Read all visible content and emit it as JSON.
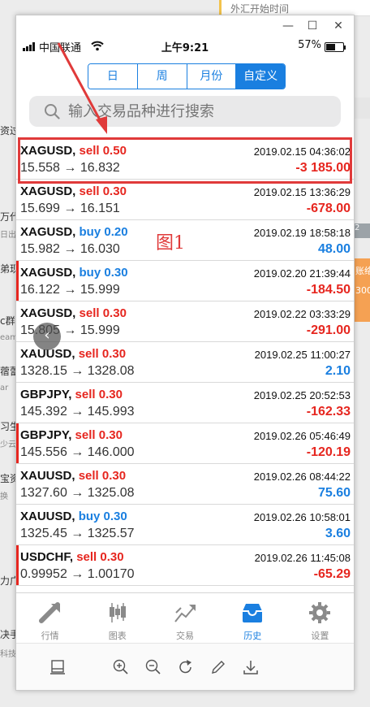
{
  "background": {
    "top_text": "外汇开始时间",
    "left_texts": [
      "资过",
      "万代",
      "日出",
      "弟现",
      "c群",
      "eam",
      "蓿蕾",
      "ar",
      "习生",
      "少云",
      "宝资",
      "换",
      "力广",
      "决手",
      "科技"
    ],
    "right_orange": "账络\n300",
    "right_grey_text": "2"
  },
  "window": {
    "minimize_label": "—",
    "maximize_label": "☐",
    "close_label": "✕"
  },
  "statusbar": {
    "carrier": "中国联通",
    "time": "上午9:21",
    "battery": "57%",
    "battery_level": 0.57
  },
  "period_tabs": [
    {
      "label": "日",
      "active": false
    },
    {
      "label": "周",
      "active": false
    },
    {
      "label": "月份",
      "active": false
    },
    {
      "label": "自定义",
      "active": true
    }
  ],
  "search": {
    "placeholder": "输入交易品种进行搜索"
  },
  "trades": [
    {
      "symbol": "XAGUSD,",
      "side": "sell",
      "volume": "0.50",
      "time": "2019.02.15 04:36:02",
      "prices": "15.558 → 16.832",
      "profit": "-3 185.00",
      "profit_color": "red",
      "bar": false
    },
    {
      "symbol": "XAGUSD,",
      "side": "sell",
      "volume": "0.30",
      "time": "2019.02.15 13:36:29",
      "prices": "15.699 → 16.151",
      "profit": "-678.00",
      "profit_color": "red",
      "bar": false
    },
    {
      "symbol": "XAGUSD,",
      "side": "buy",
      "volume": "0.20",
      "time": "2019.02.19 18:58:18",
      "prices": "15.982 → 16.030",
      "profit": "48.00",
      "profit_color": "blue",
      "bar": false
    },
    {
      "symbol": "XAGUSD,",
      "side": "buy",
      "volume": "0.30",
      "time": "2019.02.20 21:39:44",
      "prices": "16.122 → 15.999",
      "profit": "-184.50",
      "profit_color": "red",
      "bar": true
    },
    {
      "symbol": "XAGUSD,",
      "side": "sell",
      "volume": "0.30",
      "time": "2019.02.22 03:33:29",
      "prices": "15.805 → 15.999",
      "profit": "-291.00",
      "profit_color": "red",
      "bar": false
    },
    {
      "symbol": "XAUUSD,",
      "side": "sell",
      "volume": "0.30",
      "time": "2019.02.25 11:00:27",
      "prices": "1328.15 → 1328.08",
      "profit": "2.10",
      "profit_color": "blue",
      "bar": false
    },
    {
      "symbol": "GBPJPY,",
      "side": "sell",
      "volume": "0.30",
      "time": "2019.02.25 20:52:53",
      "prices": "145.392 → 145.993",
      "profit": "-162.33",
      "profit_color": "red",
      "bar": false
    },
    {
      "symbol": "GBPJPY,",
      "side": "sell",
      "volume": "0.30",
      "time": "2019.02.26 05:46:49",
      "prices": "145.556 → 146.000",
      "profit": "-120.19",
      "profit_color": "red",
      "bar": true
    },
    {
      "symbol": "XAUUSD,",
      "side": "sell",
      "volume": "0.30",
      "time": "2019.02.26 08:44:22",
      "prices": "1327.60 → 1325.08",
      "profit": "75.60",
      "profit_color": "blue",
      "bar": false
    },
    {
      "symbol": "XAUUSD,",
      "side": "buy",
      "volume": "0.30",
      "time": "2019.02.26 10:58:01",
      "prices": "1325.45 → 1325.57",
      "profit": "3.60",
      "profit_color": "blue",
      "bar": false
    },
    {
      "symbol": "USDCHF,",
      "side": "sell",
      "volume": "0.30",
      "time": "2019.02.26 11:45:08",
      "prices": "0.99952 → 1.00170",
      "profit": "-65.29",
      "profit_color": "red",
      "bar": true
    }
  ],
  "annotation": "图1",
  "bottom_nav": [
    {
      "label": "行情",
      "icon": "quotes-icon",
      "active": false
    },
    {
      "label": "图表",
      "icon": "chart-icon",
      "active": false
    },
    {
      "label": "交易",
      "icon": "trade-icon",
      "active": false
    },
    {
      "label": "历史",
      "icon": "history-icon",
      "active": true
    },
    {
      "label": "设置",
      "icon": "settings-icon",
      "active": false
    }
  ],
  "toolbar_icons": [
    "tablet-mode-icon",
    "zoom-in-icon",
    "zoom-out-icon",
    "rotate-icon",
    "edit-icon",
    "download-icon"
  ],
  "colors": {
    "accent": "#1a7fe0",
    "loss": "#e6261f",
    "highlight": "#e03a3a"
  }
}
